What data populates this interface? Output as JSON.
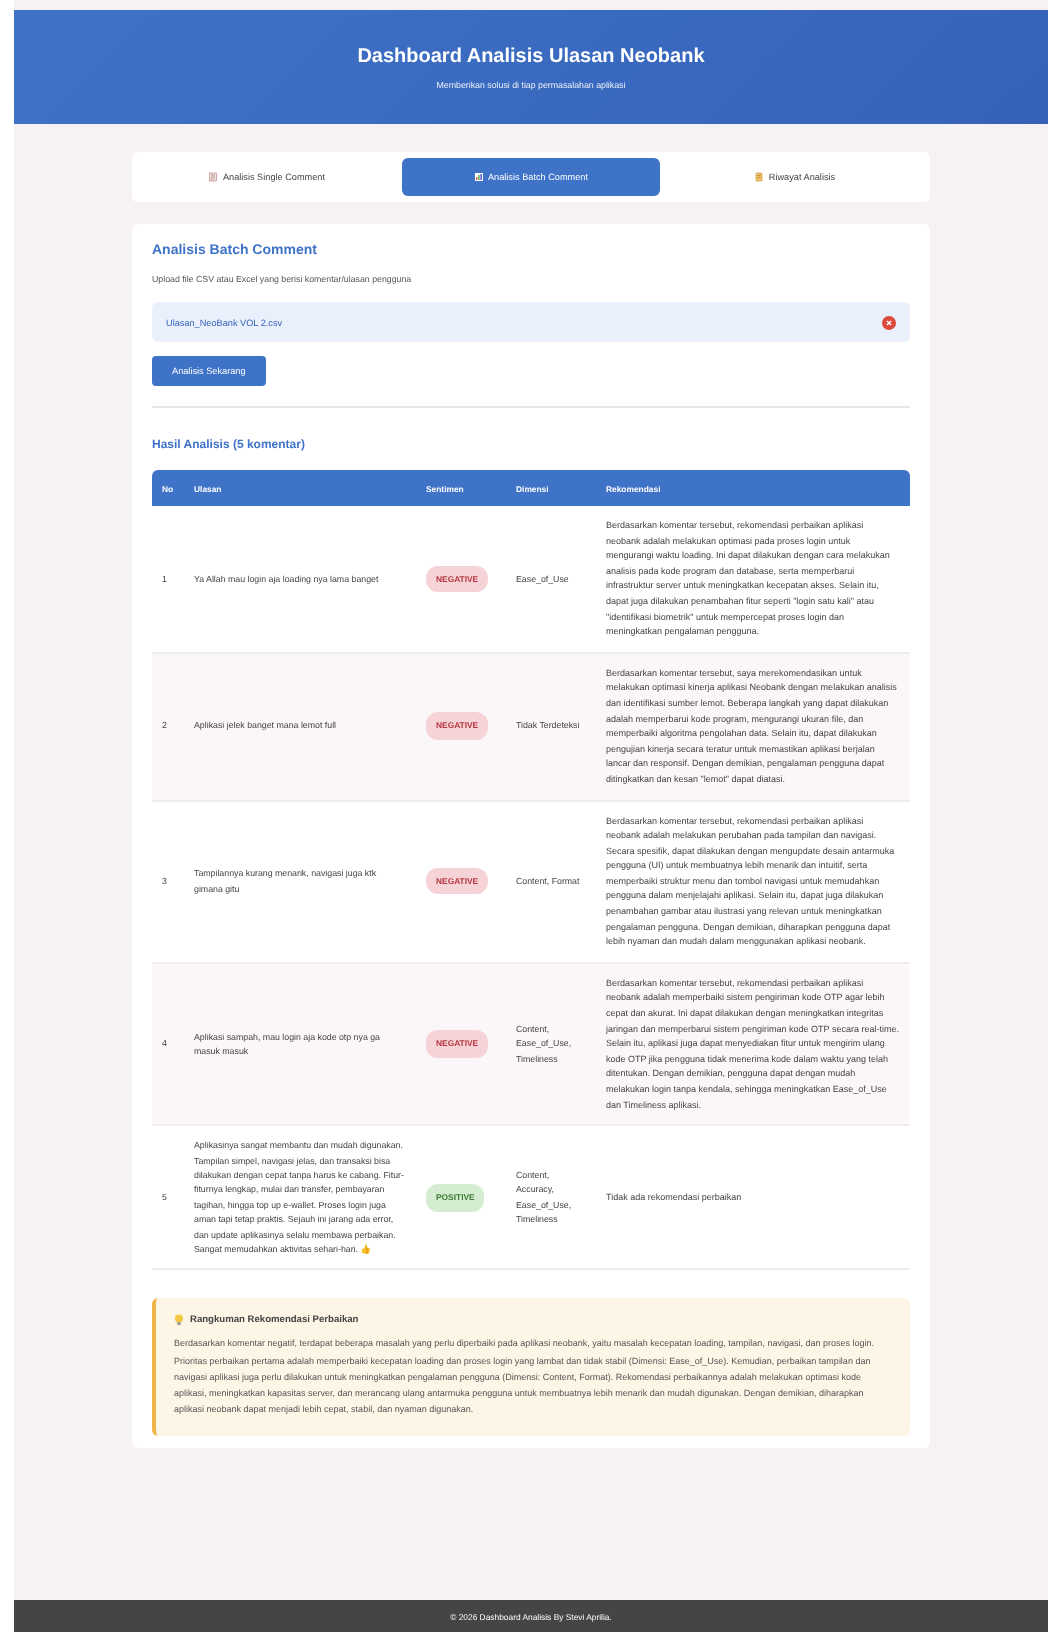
{
  "header": {
    "title": "Dashboard Analisis Ulasan Neobank",
    "subtitle": "Memberikan solusi di tiap permasalahan aplikasi"
  },
  "tabs": [
    {
      "label": "Analisis Single Comment",
      "kind": "memo",
      "selected": false
    },
    {
      "label": "Analisis Batch Comment",
      "kind": "chart",
      "selected": true
    },
    {
      "label": "Riwayat Analisis",
      "kind": "scroll",
      "selected": false
    }
  ],
  "section": {
    "title": "Analisis Batch Comment",
    "description": "Upload file CSV atau Excel yang berisi komentar/ulasan pengguna",
    "file_name": "Ulasan_NeoBank VOL 2.csv",
    "button": "Analisis Sekarang"
  },
  "results": {
    "title": "Hasil Analisis (5 komentar)",
    "columns": [
      "No",
      "Ulasan",
      "Sentimen",
      "Dimensi",
      "Rekomendasi"
    ],
    "rows": [
      {
        "no": "1",
        "ulasan": "Ya Allah mau login aja loading nya lama banget",
        "sentimen": "NEGATIVE",
        "kind": "negative",
        "dimensi": "Ease_of_Use",
        "rekomendasi": "Berdasarkan komentar tersebut, rekomendasi perbaikan aplikasi neobank adalah melakukan optimasi pada proses login untuk mengurangi waktu loading. Ini dapat dilakukan dengan cara melakukan analisis pada kode program dan database, serta memperbarui infrastruktur server untuk meningkatkan kecepatan akses. Selain itu, dapat juga dilakukan penambahan fitur seperti \"login satu kali\" atau \"identifikasi biometrik\" untuk mempercepat proses login dan meningkatkan pengalaman pengguna."
      },
      {
        "no": "2",
        "ulasan": "Aplikasi jelek banget mana lemot full",
        "sentimen": "NEGATIVE",
        "kind": "negative",
        "dimensi": "Tidak Terdeteksi",
        "rekomendasi": "Berdasarkan komentar tersebut, saya merekomendasikan untuk melakukan optimasi kinerja aplikasi Neobank dengan melakukan analisis dan identifikasi sumber lemot. Beberapa langkah yang dapat dilakukan adalah memperbarui kode program, mengurangi ukuran file, dan memperbaiki algoritma pengolahan data. Selain itu, dapat dilakukan pengujian kinerja secara teratur untuk memastikan aplikasi berjalan lancar dan responsif. Dengan demikian, pengalaman pengguna dapat ditingkatkan dan kesan \"lemot\" dapat diatasi."
      },
      {
        "no": "3",
        "ulasan": "Tampilannya kurang menarik, navigasi juga ktk gimana gitu",
        "sentimen": "NEGATIVE",
        "kind": "negative",
        "dimensi": "Content, Format",
        "rekomendasi": "Berdasarkan komentar tersebut, rekomendasi perbaikan aplikasi neobank adalah melakukan perubahan pada tampilan dan navigasi. Secara spesifik, dapat dilakukan dengan mengupdate desain antarmuka pengguna (UI) untuk membuatnya lebih menarik dan intuitif, serta memperbaiki struktur menu dan tombol navigasi untuk memudahkan pengguna dalam menjelajahi aplikasi. Selain itu, dapat juga dilakukan penambahan gambar atau ilustrasi yang relevan untuk meningkatkan pengalaman pengguna. Dengan demikian, diharapkan pengguna dapat lebih nyaman dan mudah dalam menggunakan aplikasi neobank."
      },
      {
        "no": "4",
        "ulasan": "Aplikasi sampah, mau login aja kode otp nya ga masuk masuk",
        "sentimen": "NEGATIVE",
        "kind": "negative",
        "dimensi": "Content, Ease_of_Use, Timeliness",
        "rekomendasi": "Berdasarkan komentar tersebut, rekomendasi perbaikan aplikasi neobank adalah memperbaiki sistem pengiriman kode OTP agar lebih cepat dan akurat. Ini dapat dilakukan dengan meningkatkan integritas jaringan dan memperbarui sistem pengiriman kode OTP secara real-time. Selain itu, aplikasi juga dapat menyediakan fitur untuk mengirim ulang kode OTP jika pengguna tidak menerima kode dalam waktu yang telah ditentukan. Dengan demikian, pengguna dapat dengan mudah melakukan login tanpa kendala, sehingga meningkatkan Ease_of_Use dan Timeliness aplikasi."
      },
      {
        "no": "5",
        "ulasan": "Aplikasinya sangat membantu dan mudah digunakan. Tampilan simpel, navigasi jelas, dan transaksi bisa dilakukan dengan cepat tanpa harus ke cabang. Fitur-fiturnya lengkap, mulai dari transfer, pembayaran tagihan, hingga top up e-wallet. Proses login juga aman tapi tetap praktis. Sejauh ini jarang ada error, dan update aplikasinya selalu membawa perbaikan. Sangat memudahkan aktivitas sehari-hari. 👍",
        "sentimen": "POSITIVE",
        "kind": "positive",
        "dimensi": "Content, Accuracy, Ease_of_Use, Timeliness",
        "rekomendasi": "Tidak ada rekomendasi perbaikan"
      }
    ]
  },
  "summary": {
    "title": "Rangkuman Rekomendasi Perbaikan",
    "text": "Berdasarkan komentar negatif, terdapat beberapa masalah yang perlu diperbaiki pada aplikasi neobank, yaitu masalah kecepatan loading, tampilan, navigasi, dan proses login. Prioritas perbaikan pertama adalah memperbaiki kecepatan loading dan proses login yang lambat dan tidak stabil (Dimensi: Ease_of_Use). Kemudian, perbaikan tampilan dan navigasi aplikasi juga perlu dilakukan untuk meningkatkan pengalaman pengguna (Dimensi: Content, Format). Rekomendasi perbaikannya adalah melakukan optimasi kode aplikasi, meningkatkan kapasitas server, dan merancang ulang antarmuka pengguna untuk membuatnya lebih menarik dan mudah digunakan. Dengan demikian, diharapkan aplikasi neobank dapat menjadi lebih cepat, stabil, dan nyaman digunakan."
  },
  "footer": "© 2026 Dashboard Analisis By Stevi Aprilia."
}
